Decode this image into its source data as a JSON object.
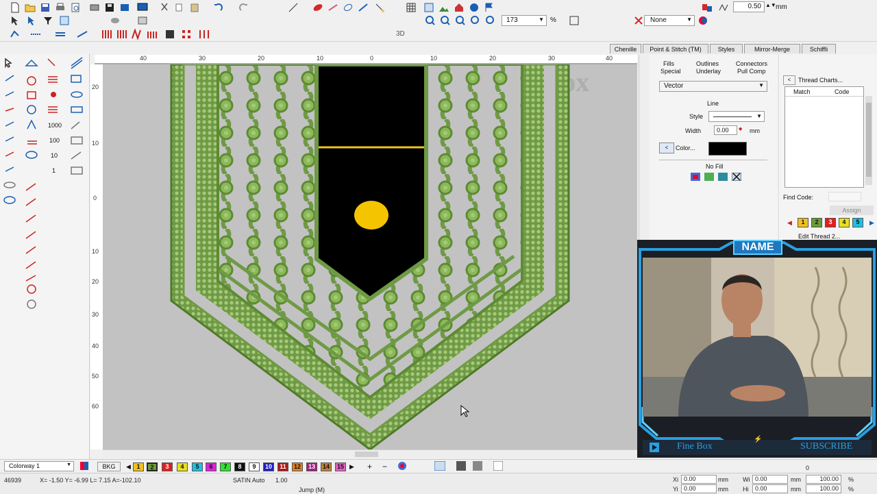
{
  "toolbar": {
    "stitch_length": "0.50",
    "unit": "mm",
    "zoom": "173",
    "zoom_unit": "%",
    "none_label": "None"
  },
  "toolbar3": {
    "label_3d": "3D"
  },
  "ruler": {
    "top": [
      "40",
      "30",
      "20",
      "10",
      "0",
      "10",
      "20",
      "30",
      "40"
    ],
    "left": [
      "20",
      "10",
      "0",
      "10",
      "20",
      "30",
      "40",
      "50",
      "60"
    ]
  },
  "panel_tabs": [
    "Chenille",
    "Point & Stitch (TM)",
    "Styles",
    "Mirror-Merge",
    "Schiffli"
  ],
  "props": {
    "subtabs_row1": [
      "Fills",
      "Outlines",
      "Connectors"
    ],
    "subtabs_row2": [
      "Special",
      "Underlay",
      "Pull Comp"
    ],
    "type_select": "Vector",
    "line_heading": "Line",
    "style_label": "Style",
    "width_label": "Width",
    "width_value": "0.00",
    "width_unit": "mm",
    "color_label": "Color...",
    "color_value": "#000000",
    "nofill_label": "No Fill"
  },
  "thread": {
    "title": "Thread Charts...",
    "col_match": "Match",
    "col_code": "Code",
    "find_label": "Find Code:",
    "assign_label": "Assign",
    "edit_label": "Edit Thread 2..."
  },
  "thread_chips": [
    {
      "label": "1",
      "color": "#f0c020"
    },
    {
      "label": "2",
      "color": "#6a9a3a"
    },
    {
      "label": "3",
      "color": "#e02020"
    },
    {
      "label": "4",
      "color": "#e8e020"
    },
    {
      "label": "5",
      "color": "#20c0e0"
    }
  ],
  "watermark": "Fine Box",
  "overlay": {
    "name_label": "NAME",
    "channel": "Fine Box",
    "subscribe": "SUBSCRIBE"
  },
  "bottom": {
    "colorway": "Colorway 1",
    "bkg": "BKG",
    "colors": [
      {
        "label": "1",
        "color": "#f0c020"
      },
      {
        "label": "2",
        "color": "#6a9a3a"
      },
      {
        "label": "3",
        "color": "#e02020"
      },
      {
        "label": "4",
        "color": "#e8e020"
      },
      {
        "label": "5",
        "color": "#20c0e0"
      },
      {
        "label": "6",
        "color": "#e020e0"
      },
      {
        "label": "7",
        "color": "#30e030"
      },
      {
        "label": "8",
        "color": "#111111"
      },
      {
        "label": "9",
        "color": "#ffffff"
      },
      {
        "label": "10",
        "color": "#2020c0"
      },
      {
        "label": "11",
        "color": "#b01818"
      },
      {
        "label": "12",
        "color": "#e08020"
      },
      {
        "label": "13",
        "color": "#a02080"
      },
      {
        "label": "14",
        "color": "#c08040"
      },
      {
        "label": "15",
        "color": "#e060c0"
      }
    ]
  },
  "status": {
    "stitches": "46939",
    "coords": "X= -1.50 Y= -6.99 L= 7.15 A=-102.10",
    "stitch_type": "SATIN Auto",
    "stitch_value": "1.00",
    "jump": "Jump (M)",
    "xi_label": "Xi",
    "xi_value": "0.00",
    "xi_unit": "mm",
    "yi_label": "Yi",
    "yi_value": "0.00",
    "yi_unit": "mm",
    "wi_label": "Wi",
    "wi_value": "0.00",
    "wi_unit": "mm",
    "hi_label": "Hi",
    "hi_value": "0.00",
    "hi_unit": "mm",
    "wp_value": "100.00",
    "wp_unit": "%",
    "hp_value": "100.00",
    "hp_unit": "%",
    "rot_value": "0"
  }
}
